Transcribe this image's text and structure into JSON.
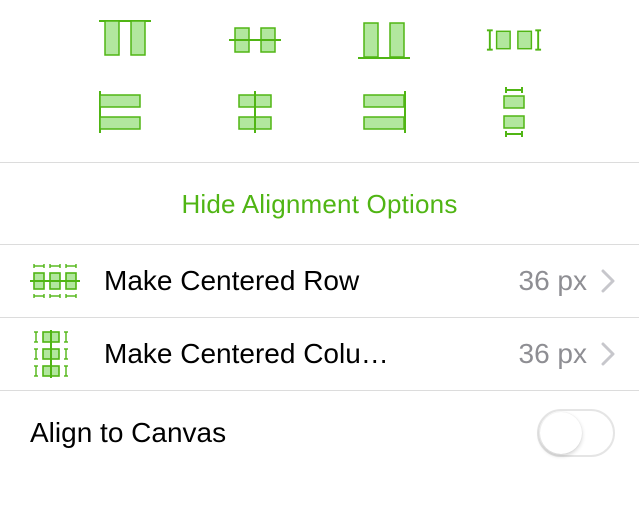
{
  "colors": {
    "accent": "#50b514",
    "accent_fill": "#b2e79e",
    "secondary_text": "#8e8e93",
    "divider": "#dcdcdc"
  },
  "alignment_grid": {
    "row1": [
      {
        "name": "align-top-icon"
      },
      {
        "name": "align-vertical-center-icon"
      },
      {
        "name": "align-bottom-icon"
      },
      {
        "name": "distribute-horizontal-icon"
      }
    ],
    "row2": [
      {
        "name": "align-left-icon"
      },
      {
        "name": "align-center-icon"
      },
      {
        "name": "align-right-icon"
      },
      {
        "name": "distribute-vertical-icon"
      }
    ]
  },
  "hide_link_label": "Hide Alignment Options",
  "actions": [
    {
      "icon": "centered-row-icon",
      "label": "Make Centered Row",
      "value": "36 px"
    },
    {
      "icon": "centered-column-icon",
      "label": "Make Centered Colu…",
      "value": "36 px"
    }
  ],
  "toggle": {
    "label": "Align to Canvas",
    "on": false
  }
}
